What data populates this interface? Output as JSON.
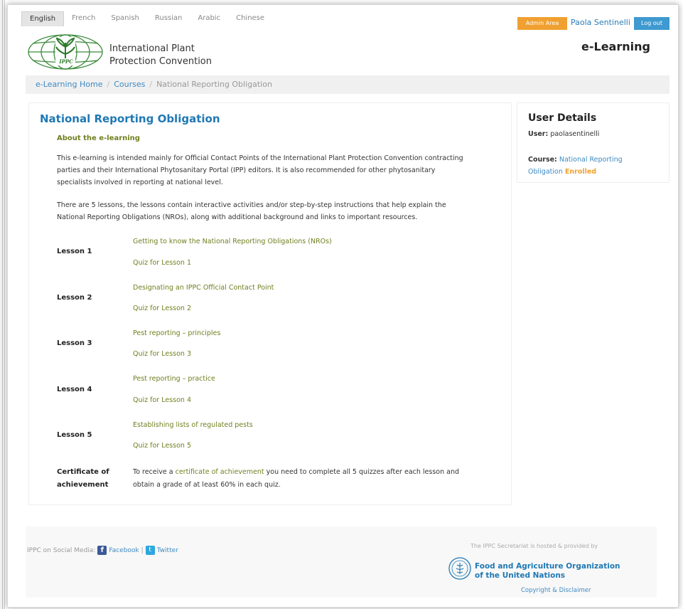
{
  "header": {
    "languages": [
      "English",
      "French",
      "Spanish",
      "Russian",
      "Arabic",
      "Chinese"
    ],
    "admin_label": "Admin Area",
    "user_name": "Paola Sentinelli",
    "logout_label": "Log out",
    "site_title": "e-Learning",
    "org_line1": "International Plant",
    "org_line2": "Protection Convention",
    "logo_text": "IPPC"
  },
  "breadcrumb": {
    "home": "e-Learning Home",
    "courses": "Courses",
    "current": "National Reporting Obligation"
  },
  "main": {
    "title": "National Reporting Obligation",
    "about_heading": "About the e-learning",
    "para1_line1": "This e-learning is intended mainly for Official Contact Points of the International Plant Protection Convention contracting",
    "para1_line2": "parties and their International Phytosanitary Portal (IPP) editors. It is also recommended for other phytosanitary",
    "para1_line3": "specialists involved in reporting at national level.",
    "para2_line1": "There are 5 lessons, the lessons contain interactive activities and/or step-by-step instructions that help explain the",
    "para2_line2": "National Reporting Obligations (NROs), along with additional background and links to important resources.",
    "lessons": [
      {
        "label": "Lesson 1",
        "title": "Getting to know the National Reporting Obligations (NROs)",
        "quiz": "Quiz for Lesson 1"
      },
      {
        "label": "Lesson 2",
        "title": "Designating an IPPC Official Contact Point",
        "quiz": "Quiz for Lesson 2"
      },
      {
        "label": "Lesson 3",
        "title": "Pest reporting – principles",
        "quiz": "Quiz for Lesson 3"
      },
      {
        "label": "Lesson 4",
        "title": "Pest reporting – practice",
        "quiz": "Quiz for Lesson 4"
      },
      {
        "label": "Lesson 5",
        "title": "Establishing lists of regulated pests",
        "quiz": "Quiz for Lesson 5"
      }
    ],
    "cert_label_line1": "Certificate of",
    "cert_label_line2": "achievement",
    "cert_text_pre": "To receive a ",
    "cert_link": "certificate of achievement",
    "cert_text_post": " you need to complete all 5 quizzes after each lesson and",
    "cert_text_line2": "obtain a grade of at least 60% in each quiz."
  },
  "sidebar": {
    "title": "User Details",
    "user_label": "User:",
    "user_value": "paolasentinelli",
    "course_label": "Course:",
    "course_value_line1": "National Reporting",
    "course_value_line2": "Obligation",
    "status": "Enrolled"
  },
  "footer": {
    "social_label": "IPPC on Social Media:",
    "facebook": "Facebook",
    "separator": "|",
    "twitter": "Twitter",
    "hosted": "The IPPC Secretariat is hosted & provided by",
    "fao_line1": "Food and Agriculture Organization",
    "fao_line2": "of the United Nations",
    "copyright": "Copyright & Disclaimer"
  }
}
